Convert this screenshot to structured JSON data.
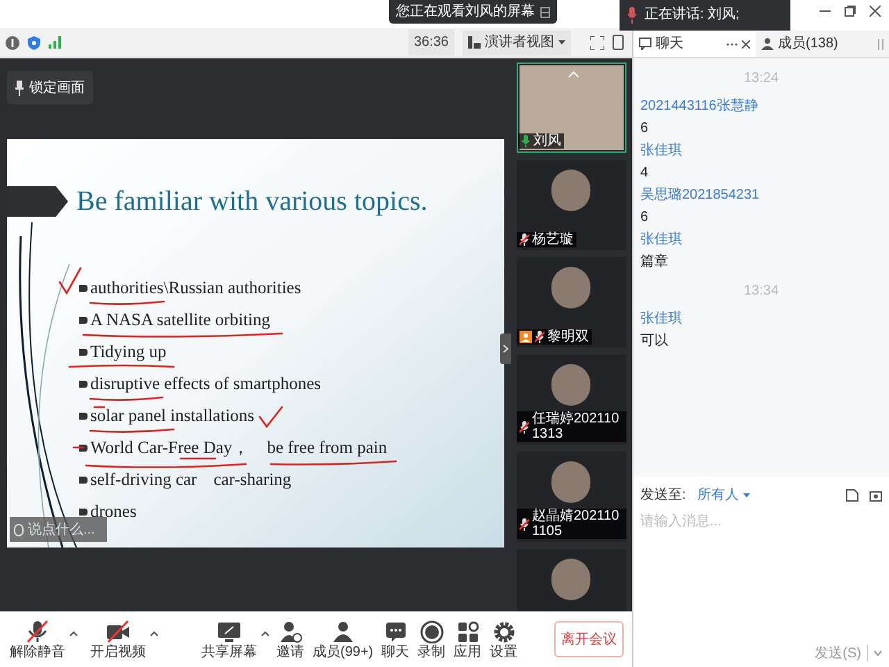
{
  "screen_share_banner": "您正在观看刘风的屏幕",
  "speaking_indicator": "正在讲话: 刘风;",
  "top_bar": {
    "timer": "36:36",
    "view_button": "演讲者视图"
  },
  "lock_button": "锁定画面",
  "slide": {
    "title": "Be familiar with various topics.",
    "bullets": [
      {
        "parts": [
          "authorities\\Russian authorities"
        ]
      },
      {
        "parts": [
          "A NASA satellite orbiting"
        ]
      },
      {
        "parts": [
          "Tidying up"
        ]
      },
      {
        "parts": [
          "disruptive effects of smartphones"
        ]
      },
      {
        "parts": [
          "solar panel installations"
        ]
      },
      {
        "parts": [
          "World Car-Free Day，",
          "be free from pain"
        ]
      },
      {
        "parts": [
          "self-driving car",
          "car-sharing"
        ]
      },
      {
        "parts": [
          "drones"
        ]
      }
    ]
  },
  "comment_box": {
    "placeholder": "说点什么..."
  },
  "participants": [
    {
      "kind": "video",
      "name": "刘风",
      "mic_on": true,
      "host": false
    },
    {
      "kind": "avatar",
      "name": "杨艺璇",
      "mic_on": false,
      "host": false
    },
    {
      "kind": "avatar",
      "name": "黎明双",
      "mic_on": false,
      "host": true
    },
    {
      "kind": "avatar",
      "name": "任瑞婷2021101313",
      "mic_on": false,
      "host": false
    },
    {
      "kind": "avatar",
      "name": "赵晶婧2021101105",
      "mic_on": false,
      "host": false
    },
    {
      "kind": "avatar"
    }
  ],
  "chat": {
    "tabs": [
      {
        "label": "聊天",
        "selected": true
      },
      {
        "label": "成员(138)",
        "selected": false
      }
    ],
    "messages": [
      {
        "kind": "time",
        "text": "13:24"
      },
      {
        "kind": "sender",
        "text": "2021443116张慧静"
      },
      {
        "kind": "text",
        "text": "6"
      },
      {
        "kind": "sender",
        "text": "张佳琪"
      },
      {
        "kind": "text",
        "text": "4"
      },
      {
        "kind": "sender",
        "text": "吴思璐2021854231"
      },
      {
        "kind": "text",
        "text": "6"
      },
      {
        "kind": "sender",
        "text": "张佳琪"
      },
      {
        "kind": "text",
        "text": "篇章"
      },
      {
        "kind": "time",
        "text": "13:34"
      },
      {
        "kind": "sender",
        "text": "张佳琪"
      },
      {
        "kind": "text",
        "text": "可以"
      }
    ],
    "send_to_label": "发送至:",
    "recipient": "所有人",
    "placeholder": "请输入消息...",
    "send_button": "发送(S)"
  },
  "toolbar": {
    "left": [
      {
        "label": "解除静音",
        "off": true
      },
      {
        "label": "开启视频",
        "off": true
      }
    ],
    "center": [
      {
        "label": "共享屏幕",
        "off": false
      },
      {
        "label": "邀请",
        "off": false
      },
      {
        "label": "成员(99+)",
        "off": false
      },
      {
        "label": "聊天",
        "off": false
      },
      {
        "label": "录制",
        "off": false
      },
      {
        "label": "应用",
        "off": false
      },
      {
        "label": "设置",
        "off": false
      }
    ],
    "leave_button": "离开会议"
  }
}
